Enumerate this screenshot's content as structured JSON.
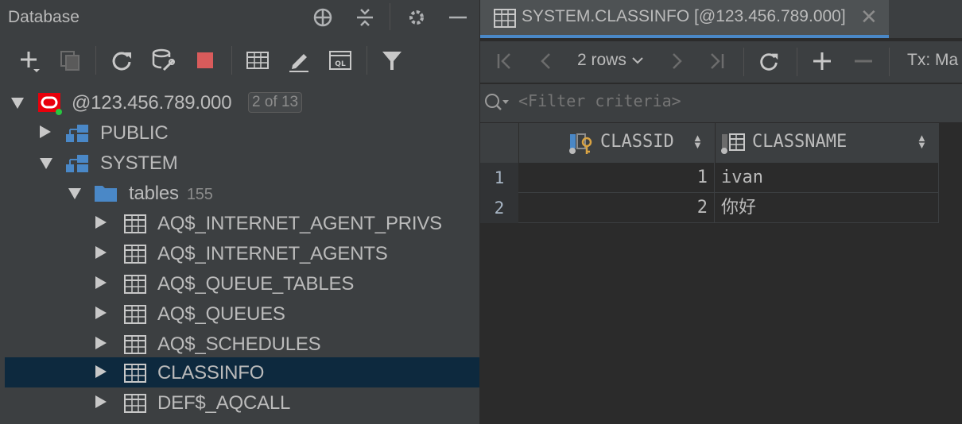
{
  "left_panel": {
    "title": "Database",
    "icons": [
      "crosshair-icon",
      "collapse-icon",
      "gear-icon",
      "minimize-icon"
    ],
    "toolbar_icons": [
      "add-icon",
      "duplicate-icon",
      "refresh-icon",
      "schema-sync-icon",
      "stop-icon",
      "table-icon",
      "edit-icon",
      "sql-console-icon",
      "filter-icon"
    ]
  },
  "tree": {
    "connection": {
      "label": "@123.456.789.000",
      "badge": "2 of 13",
      "icon": "oracle-icon",
      "status_color": "#28c840"
    },
    "schemas": [
      {
        "label": "PUBLIC",
        "expanded": false
      },
      {
        "label": "SYSTEM",
        "expanded": true
      }
    ],
    "folder": {
      "label": "tables",
      "count": "155"
    },
    "tables": [
      {
        "label": "AQ$_INTERNET_AGENT_PRIVS",
        "selected": false
      },
      {
        "label": "AQ$_INTERNET_AGENTS",
        "selected": false
      },
      {
        "label": "AQ$_QUEUE_TABLES",
        "selected": false
      },
      {
        "label": "AQ$_QUEUES",
        "selected": false
      },
      {
        "label": "AQ$_SCHEDULES",
        "selected": false
      },
      {
        "label": "CLASSINFO",
        "selected": true
      },
      {
        "label": "DEF$_AQCALL",
        "selected": false
      }
    ]
  },
  "editor": {
    "tab": {
      "title": "SYSTEM.CLASSINFO [@123.456.789.000]",
      "close": "✕"
    },
    "toolbar": {
      "rows_label": "2 rows",
      "tx_label": "Tx: Ma"
    },
    "filter": {
      "placeholder": "<Filter criteria>"
    },
    "columns": [
      {
        "name": "CLASSID",
        "icon": "primary-key-column-icon"
      },
      {
        "name": "CLASSNAME",
        "icon": "column-icon"
      }
    ],
    "rows": [
      {
        "num": "1",
        "classid": "1",
        "classname": "ivan"
      },
      {
        "num": "2",
        "classid": "2",
        "classname": "你好"
      }
    ]
  },
  "colors": {
    "accent": "#4a88c7",
    "selection": "#0d293e",
    "stop": "#d95b5b",
    "oracle_red": "#e8000b"
  }
}
